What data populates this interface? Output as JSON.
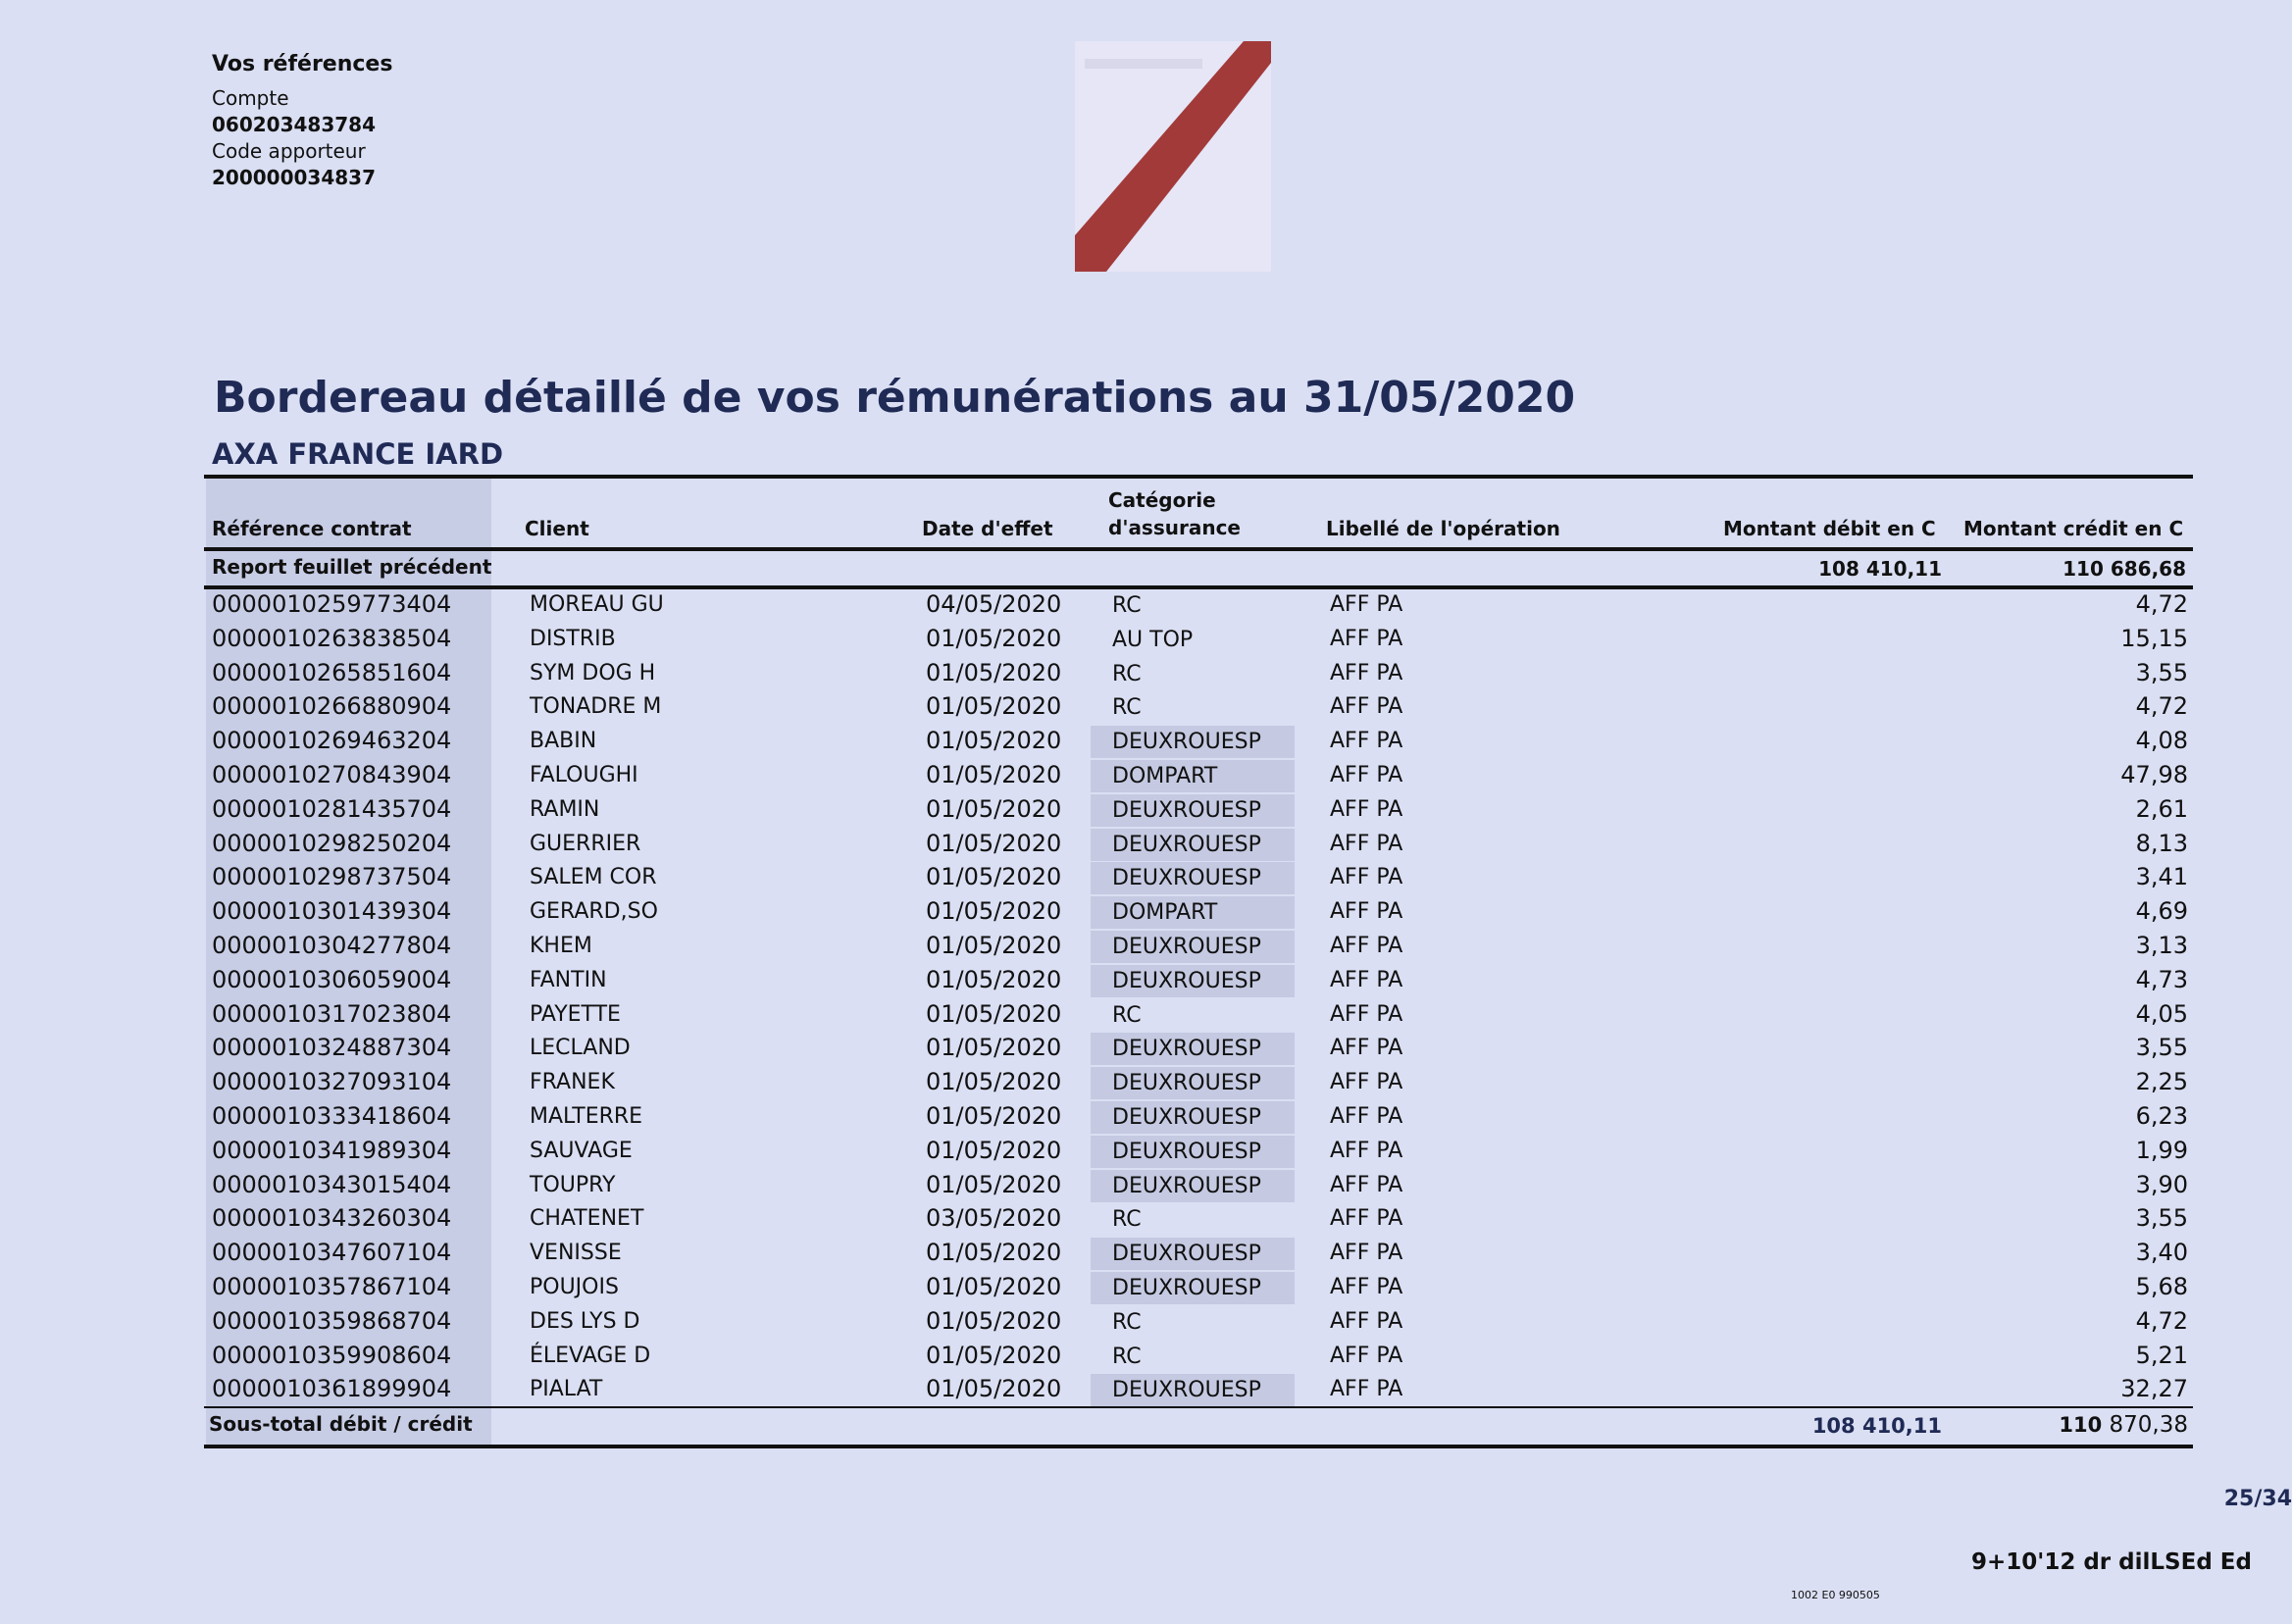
{
  "references": {
    "title": "Vos références",
    "account_label": "Compte",
    "account_value": "060203483784",
    "code_label": "Code apporteur",
    "code_value": "200000034837"
  },
  "title": "Bordereau détaillé de vos rémunérations au 31/05/2020",
  "company": "AXA FRANCE IARD",
  "columns": {
    "ref": "Référence contrat",
    "client": "Client",
    "date": "Date d'effet",
    "category_line1": "Catégorie",
    "category_line2": "d'assurance",
    "libelle": "Libellé de l'opération",
    "debit": "Montant débit en C",
    "credit": "Montant crédit en C"
  },
  "report": {
    "label": "Report feuillet précédent",
    "debit": "108 410,11",
    "credit": "110 686,68"
  },
  "rows": [
    {
      "ref": "0000010259773404",
      "client": "MOREAU GU",
      "date": "04/05/2020",
      "category": "RC",
      "shaded": false,
      "libelle": "AFF PA",
      "credit": "4,72"
    },
    {
      "ref": "0000010263838504",
      "client": "DISTRIB",
      "date": "01/05/2020",
      "category": "AU TOP",
      "shaded": false,
      "libelle": "AFF PA",
      "credit": "15,15"
    },
    {
      "ref": "0000010265851604",
      "client": "SYM DOG H",
      "date": "01/05/2020",
      "category": "RC",
      "shaded": false,
      "libelle": "AFF PA",
      "credit": "3,55"
    },
    {
      "ref": "0000010266880904",
      "client": "TONADRE M",
      "date": "01/05/2020",
      "category": "RC",
      "shaded": false,
      "libelle": "AFF PA",
      "credit": "4,72"
    },
    {
      "ref": "0000010269463204",
      "client": "BABIN",
      "date": "01/05/2020",
      "category": "DEUXROUESP",
      "shaded": true,
      "libelle": "AFF PA",
      "credit": "4,08"
    },
    {
      "ref": "0000010270843904",
      "client": "FALOUGHI",
      "date": "01/05/2020",
      "category": "DOMPART",
      "shaded": true,
      "libelle": "AFF PA",
      "credit": "47,98"
    },
    {
      "ref": "0000010281435704",
      "client": "RAMIN",
      "date": "01/05/2020",
      "category": "DEUXROUESP",
      "shaded": true,
      "libelle": "AFF PA",
      "credit": "2,61"
    },
    {
      "ref": "0000010298250204",
      "client": "GUERRIER",
      "date": "01/05/2020",
      "category": "DEUXROUESP",
      "shaded": true,
      "libelle": "AFF PA",
      "credit": "8,13"
    },
    {
      "ref": "0000010298737504",
      "client": "SALEM COR",
      "date": "01/05/2020",
      "category": "DEUXROUESP",
      "shaded": true,
      "libelle": "AFF PA",
      "credit": "3,41"
    },
    {
      "ref": "0000010301439304",
      "client": "GERARD,SO",
      "date": "01/05/2020",
      "category": "DOMPART",
      "shaded": true,
      "libelle": "AFF PA",
      "credit": "4,69"
    },
    {
      "ref": "0000010304277804",
      "client": "KHEM",
      "date": "01/05/2020",
      "category": "DEUXROUESP",
      "shaded": true,
      "libelle": "AFF PA",
      "credit": "3,13"
    },
    {
      "ref": "0000010306059004",
      "client": "FANTIN",
      "date": "01/05/2020",
      "category": "DEUXROUESP",
      "shaded": true,
      "libelle": "AFF PA",
      "credit": "4,73"
    },
    {
      "ref": "0000010317023804",
      "client": "PAYETTE",
      "date": "01/05/2020",
      "category": "RC",
      "shaded": false,
      "libelle": "AFF PA",
      "credit": "4,05"
    },
    {
      "ref": "0000010324887304",
      "client": "LECLAND",
      "date": "01/05/2020",
      "category": "DEUXROUESP",
      "shaded": true,
      "libelle": "AFF PA",
      "credit": "3,55"
    },
    {
      "ref": "0000010327093104",
      "client": "FRANEK",
      "date": "01/05/2020",
      "category": "DEUXROUESP",
      "shaded": true,
      "libelle": "AFF PA",
      "credit": "2,25"
    },
    {
      "ref": "0000010333418604",
      "client": "MALTERRE",
      "date": "01/05/2020",
      "category": "DEUXROUESP",
      "shaded": true,
      "libelle": "AFF PA",
      "credit": "6,23"
    },
    {
      "ref": "0000010341989304",
      "client": "SAUVAGE",
      "date": "01/05/2020",
      "category": "DEUXROUESP",
      "shaded": true,
      "libelle": "AFF PA",
      "credit": "1,99"
    },
    {
      "ref": "0000010343015404",
      "client": "TOUPRY",
      "date": "01/05/2020",
      "category": "DEUXROUESP",
      "shaded": true,
      "libelle": "AFF PA",
      "credit": "3,90"
    },
    {
      "ref": "0000010343260304",
      "client": "CHATENET",
      "date": "03/05/2020",
      "category": "RC",
      "shaded": false,
      "libelle": "AFF PA",
      "credit": "3,55"
    },
    {
      "ref": "0000010347607104",
      "client": "VENISSE",
      "date": "01/05/2020",
      "category": "DEUXROUESP",
      "shaded": true,
      "libelle": "AFF PA",
      "credit": "3,40"
    },
    {
      "ref": "0000010357867104",
      "client": "POUJOIS",
      "date": "01/05/2020",
      "category": "DEUXROUESP",
      "shaded": true,
      "libelle": "AFF PA",
      "credit": "5,68"
    },
    {
      "ref": "0000010359868704",
      "client": "DES LYS D",
      "date": "01/05/2020",
      "category": "RC",
      "shaded": false,
      "libelle": "AFF PA",
      "credit": "4,72"
    },
    {
      "ref": "0000010359908604",
      "client": "ÉLEVAGE D",
      "date": "01/05/2020",
      "category": "RC",
      "shaded": false,
      "libelle": "AFF PA",
      "credit": "5,21"
    },
    {
      "ref": "0000010361899904",
      "client": "PIALAT",
      "date": "01/05/2020",
      "category": "DEUXROUESP",
      "shaded": true,
      "libelle": "AFF PA",
      "credit": "32,27"
    }
  ],
  "subtotal": {
    "label": "Sous-total débit / crédit",
    "debit": "108 410,11",
    "credit_bold": "110",
    "credit_rest": "870,38"
  },
  "page": "25/34",
  "footer_code": "9+10'12 dr dilLSEd Ed",
  "small_code": "1002 E0 990505",
  "colors": {
    "background": "#dadff3",
    "title": "#1f2a55",
    "stamp_stripe": "#a23a3a",
    "shade": "#c8cde6"
  }
}
